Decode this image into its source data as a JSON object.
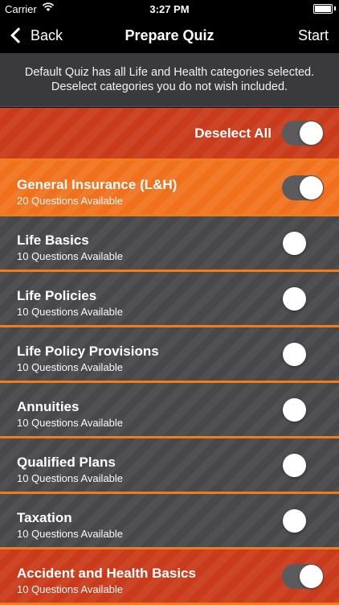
{
  "status": {
    "carrier": "Carrier",
    "time": "3:27 PM"
  },
  "nav": {
    "back_label": "Back",
    "title": "Prepare Quiz",
    "start_label": "Start"
  },
  "info": {
    "line1": "Default Quiz has all Life and Health categories selected.",
    "line2": "Deselect categories you do not wish included."
  },
  "deselect": {
    "label": "Deselect All",
    "on": true
  },
  "colors": {
    "red": "#c93b1a",
    "orange": "#f0701b",
    "gray": "#48484a",
    "separator": "#f07c1e"
  },
  "categories": [
    {
      "title": "General Insurance (L&H)",
      "subtitle": "20 Questions Available",
      "style": "orange",
      "on": true
    },
    {
      "title": "Life Basics",
      "subtitle": "10 Questions Available",
      "style": "gray",
      "on": false
    },
    {
      "title": "Life Policies",
      "subtitle": "10 Questions Available",
      "style": "gray",
      "on": false
    },
    {
      "title": "Life Policy Provisions",
      "subtitle": "10 Questions Available",
      "style": "gray",
      "on": false
    },
    {
      "title": "Annuities",
      "subtitle": "10 Questions Available",
      "style": "gray",
      "on": false
    },
    {
      "title": "Qualified Plans",
      "subtitle": "10 Questions Available",
      "style": "gray",
      "on": false
    },
    {
      "title": "Taxation",
      "subtitle": "10 Questions Available",
      "style": "gray",
      "on": false
    },
    {
      "title": "Accident and Health Basics",
      "subtitle": "10 Questions Available",
      "style": "red",
      "on": true
    }
  ]
}
